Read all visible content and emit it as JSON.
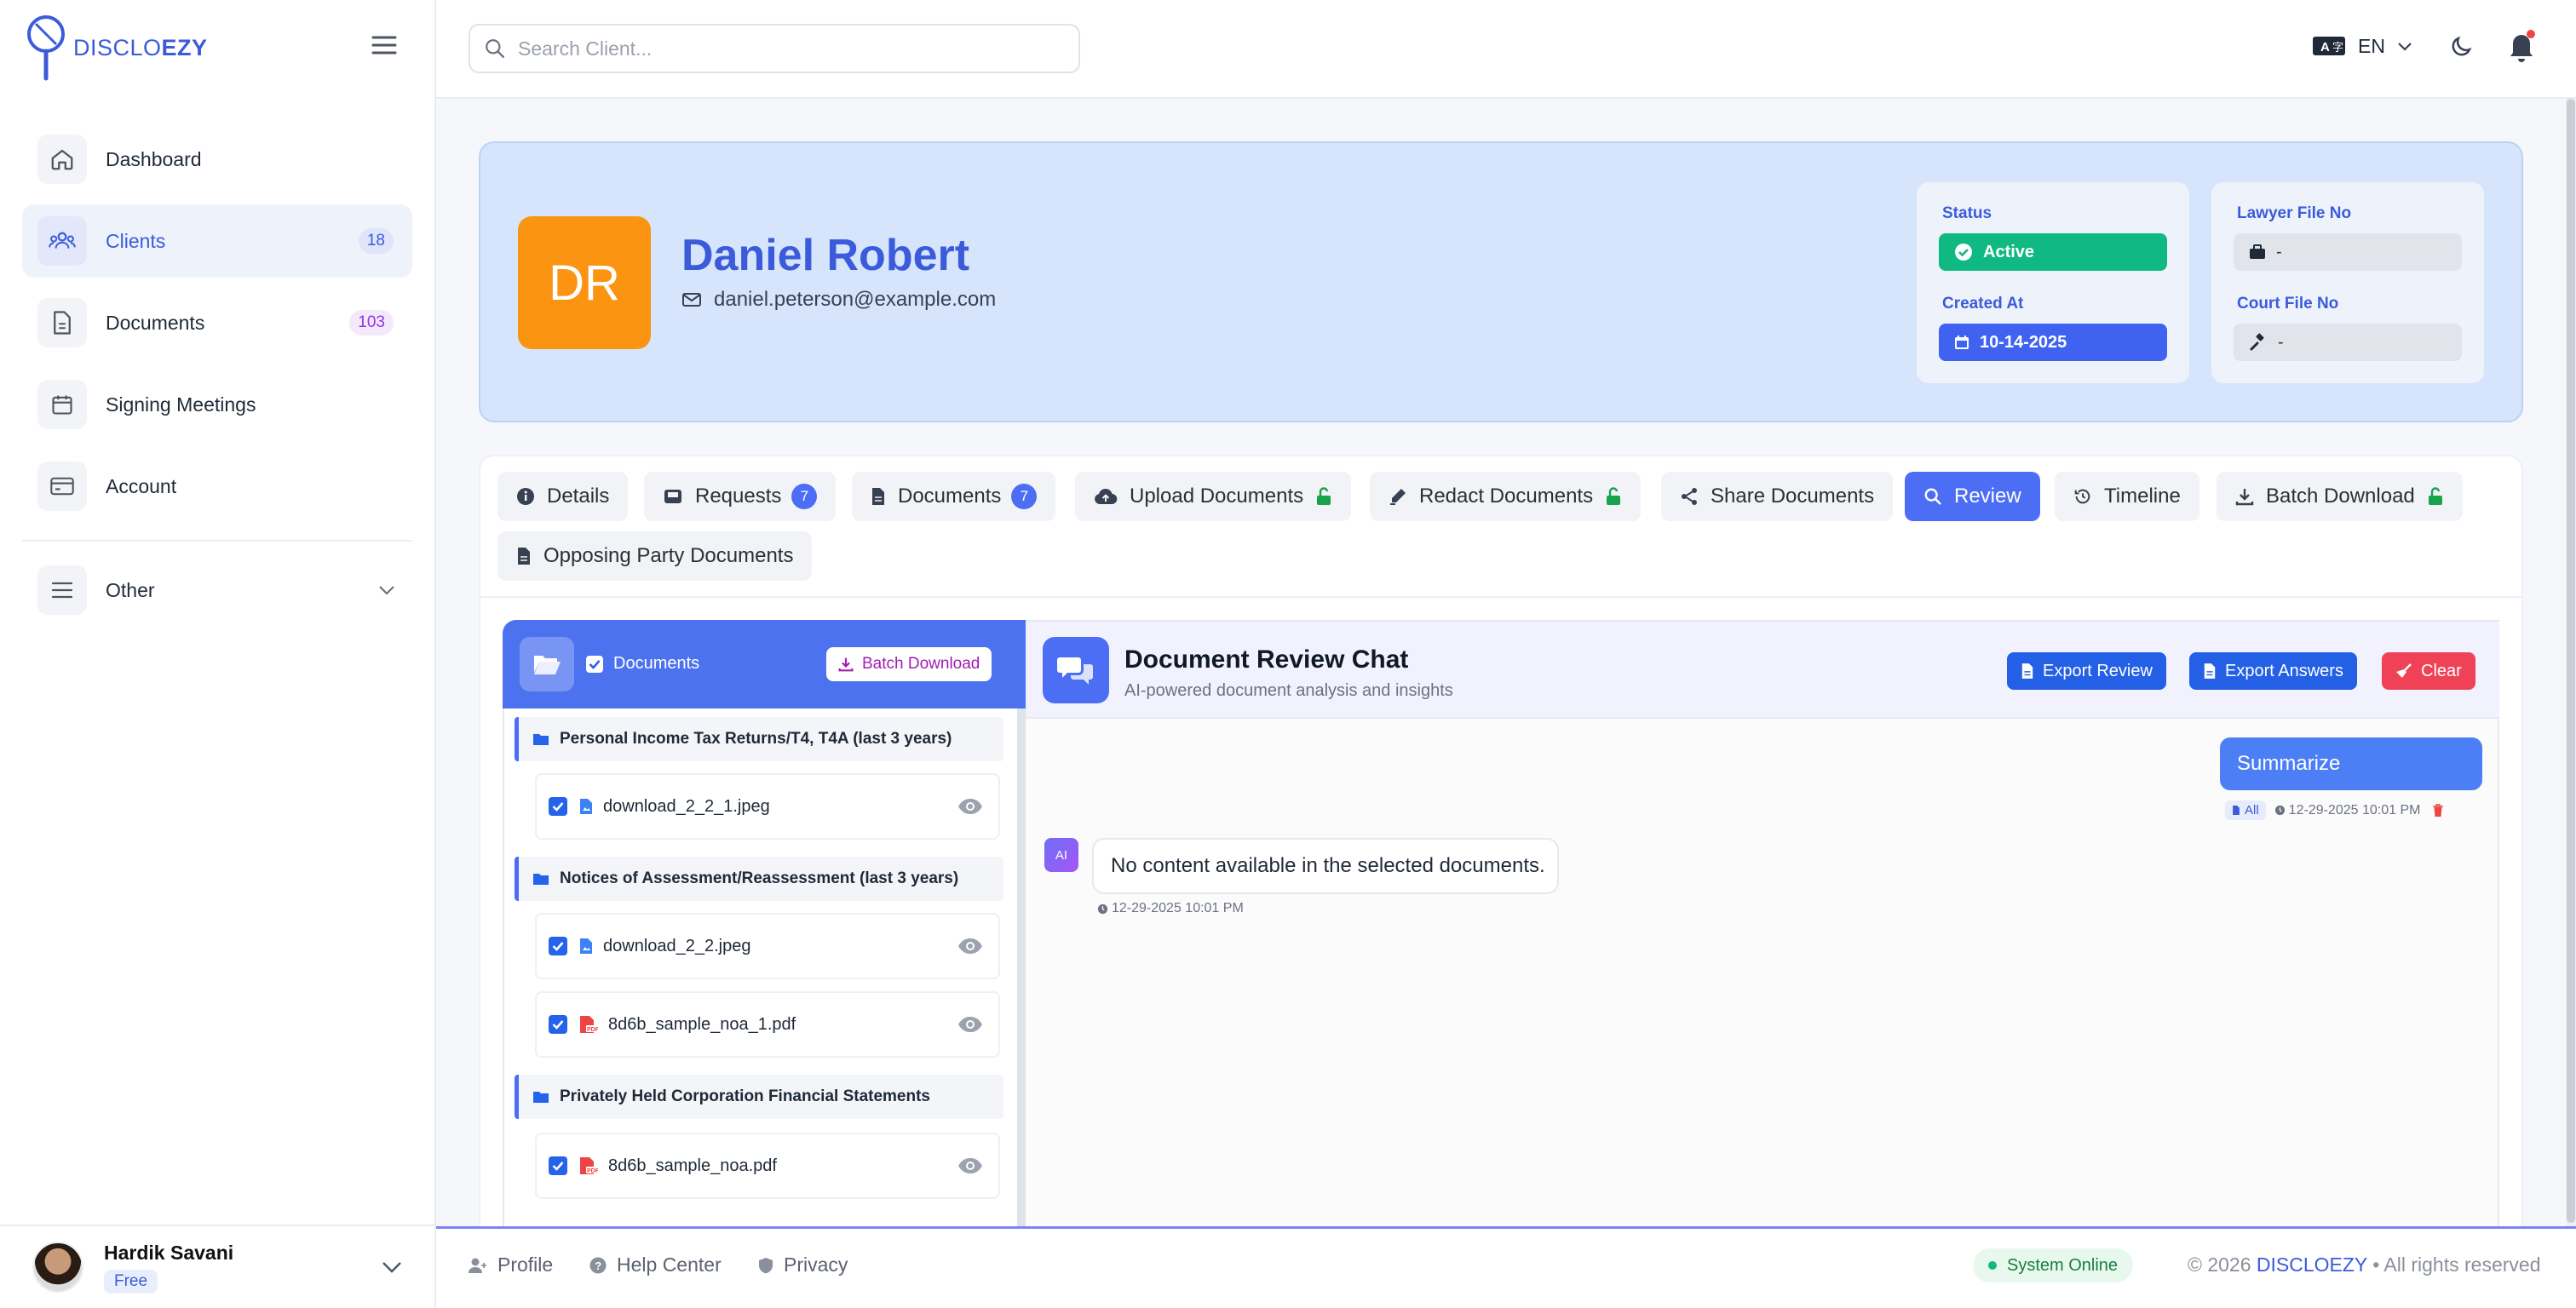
{
  "brand": {
    "logo_text_light": "DISCLO",
    "logo_text_bold": "EZY"
  },
  "sidebar": {
    "items": [
      {
        "label": "Dashboard"
      },
      {
        "label": "Clients",
        "badge": "18"
      },
      {
        "label": "Documents",
        "badge": "103"
      },
      {
        "label": "Signing Meetings"
      },
      {
        "label": "Account"
      },
      {
        "label": "Other"
      }
    ],
    "user": {
      "name": "Hardik Savani",
      "plan": "Free"
    }
  },
  "topbar": {
    "search_placeholder": "Search Client...",
    "language": "EN"
  },
  "client": {
    "initials": "DR",
    "name": "Daniel Robert",
    "email": "daniel.peterson@example.com",
    "status_label": "Status",
    "status": "Active",
    "created_label": "Created At",
    "created": "10-14-2025",
    "lawyer_label": "Lawyer File No",
    "lawyer_value": "-",
    "court_label": "Court File No",
    "court_value": "-"
  },
  "tabs": [
    {
      "label": "Details"
    },
    {
      "label": "Requests",
      "badge": "7"
    },
    {
      "label": "Documents",
      "badge": "7"
    },
    {
      "label": "Upload Documents"
    },
    {
      "label": "Redact Documents"
    },
    {
      "label": "Share Documents"
    },
    {
      "label": "Review",
      "active": true
    },
    {
      "label": "Timeline"
    },
    {
      "label": "Batch Download"
    },
    {
      "label": "Opposing Party Documents"
    }
  ],
  "doc_panel": {
    "header_label": "Documents",
    "batch_button": "Batch Download",
    "folders": [
      {
        "name": "Personal Income Tax Returns/T4, T4A (last 3 years)",
        "files": [
          "download_2_2_1.jpeg"
        ]
      },
      {
        "name": "Notices of Assessment/Reassessment (last 3 years)",
        "files": [
          "download_2_2.jpeg",
          "8d6b_sample_noa_1.pdf"
        ]
      },
      {
        "name": "Privately Held Corporation Financial Statements",
        "files": [
          "8d6b_sample_noa.pdf"
        ]
      }
    ]
  },
  "chat": {
    "title": "Document Review Chat",
    "subtitle": "AI-powered document analysis and insights",
    "export_review": "Export Review",
    "export_answers": "Export Answers",
    "clear": "Clear",
    "user_message": "Summarize",
    "user_scope": "All",
    "user_time": "12-29-2025 10:01 PM",
    "ai_avatar": "AI",
    "ai_message": "No content available in the selected documents.",
    "ai_time": "12-29-2025 10:01 PM"
  },
  "footer": {
    "profile": "Profile",
    "help": "Help Center",
    "privacy": "Privacy",
    "status": "System Online",
    "copyright_prefix": "© 2026",
    "copyright_brand": "DISCLOEZY",
    "copyright_suffix": "• All rights reserved"
  },
  "colors": {
    "accent": "#4c6ef5",
    "brand_text": "#3b5bdb",
    "status_active": "#10b981",
    "avatar_orange": "#fb9411",
    "clear_red": "#ef4256",
    "lock_green": "#16a34a"
  }
}
